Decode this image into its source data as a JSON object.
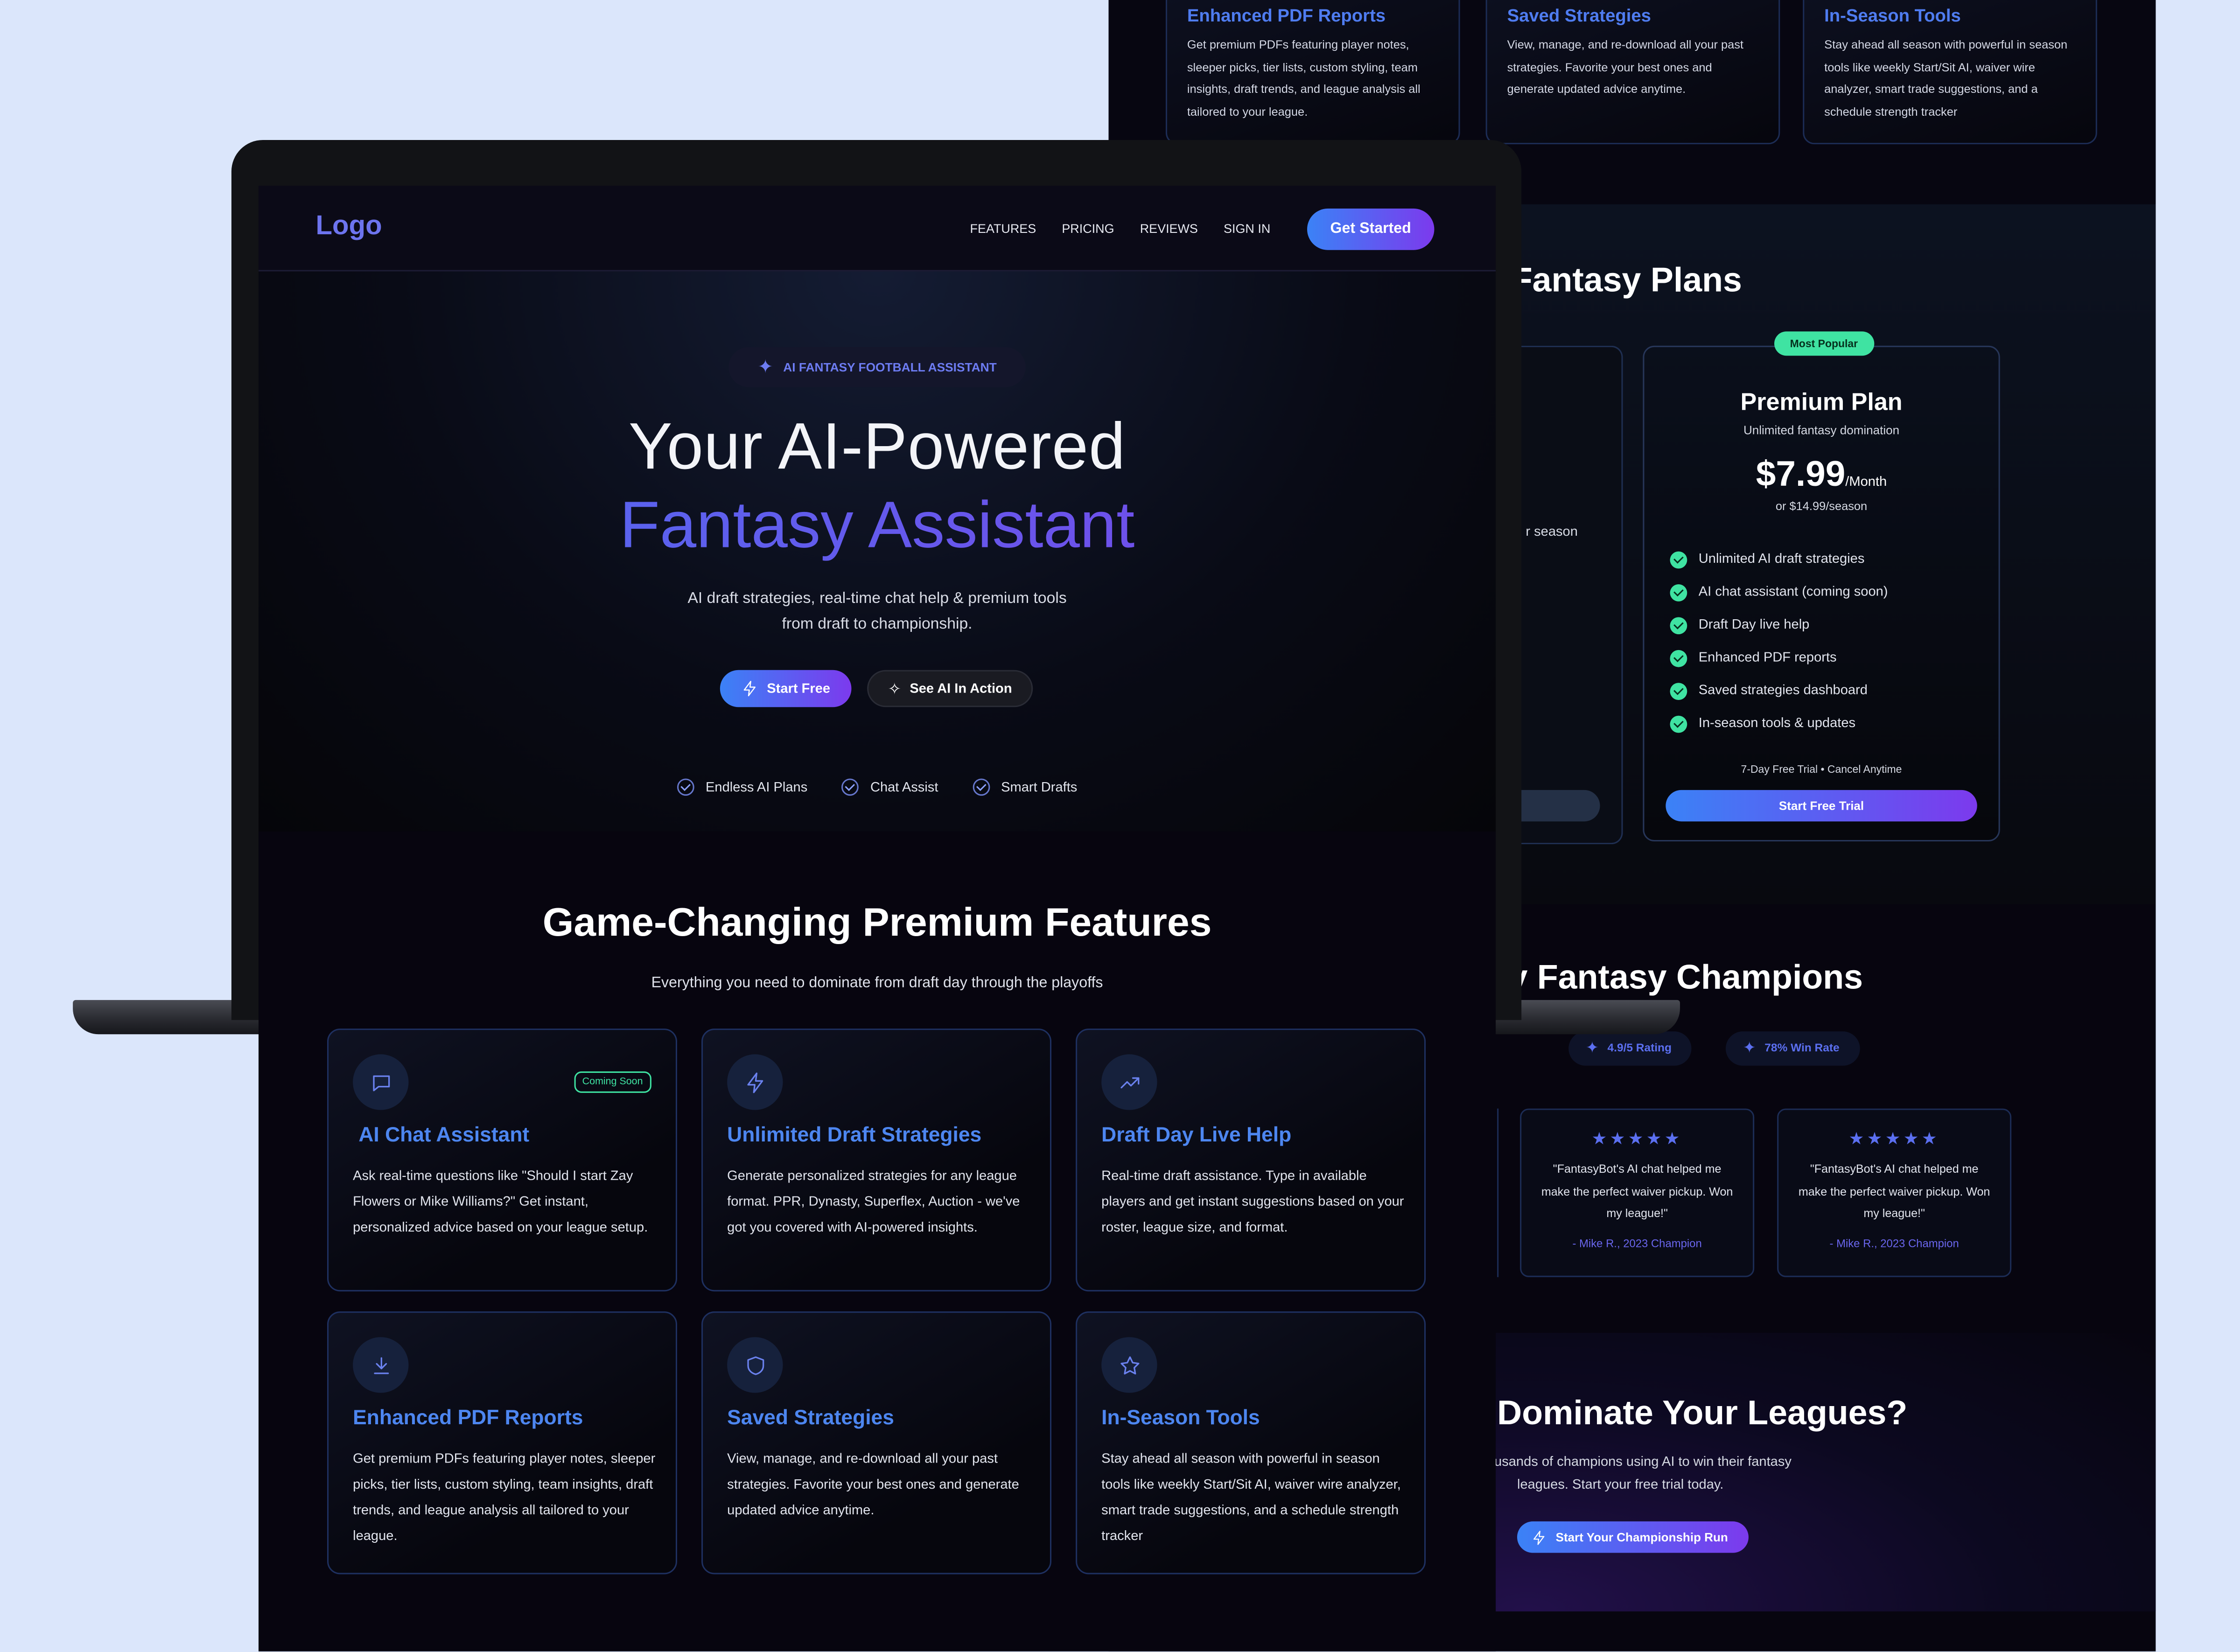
{
  "back_page": {
    "feature_cards": [
      {
        "title": "Enhanced PDF Reports",
        "body": "Get premium PDFs featuring player notes, sleeper picks, tier lists, custom styling, team insights, draft trends, and league analysis all tailored to your league."
      },
      {
        "title": "Saved Strategies",
        "body": "View, manage, and re-download all your past strategies. Favorite your best ones and generate updated advice anytime."
      },
      {
        "title": "In-Season Tools",
        "body": "Stay ahead all season with powerful in season tools like weekly Start/Sit AI, waiver wire analyzer, smart trade suggestions, and a schedule strength tracker"
      }
    ],
    "pricing": {
      "heading_visible": "Fantasy Plans",
      "left_card_fragment": "r season",
      "badge": "Most Popular",
      "plan_name": "Premium Plan",
      "plan_sub": "Unlimited fantasy domination",
      "price": "$7.99",
      "price_unit": "/Month",
      "alt_price": "or $14.99/season",
      "features": [
        "Unlimited AI draft strategies",
        "AI chat assistant (coming soon)",
        "Draft Day live help",
        "Enhanced PDF reports",
        "Saved strategies dashboard",
        "In-season tools & updates"
      ],
      "trial_note": "7-Day Free Trial • Cancel Anytime",
      "trial_button": "Start Free Trial"
    },
    "reviews": {
      "heading_visible": "y Fantasy Champions",
      "pills": [
        "4.9/5 Rating",
        "78% Win Rate"
      ],
      "stars": "★★★★★",
      "cards": [
        {
          "quote": "\"FantasyBot's AI chat helped me make the perfect waiver pickup. Won my league!\"",
          "author": "- Mike R., 2023 Champion"
        },
        {
          "quote": "\"FantasyBot's AI chat helped me make the perfect waiver pickup. Won my league!\"",
          "author": "- Mike R., 2023 Champion"
        }
      ]
    },
    "cta": {
      "heading_visible": "Dominate Your Leagues?",
      "sub_line1": "usands of champions using AI to win their fantasy",
      "sub_line2": "leagues. Start your free trial today.",
      "button": "Start Your Championship Run"
    }
  },
  "nav": {
    "logo": "Logo",
    "links": [
      "FEATURES",
      "PRICING",
      "REVIEWS",
      "SIGN IN"
    ],
    "cta": "Get Started"
  },
  "hero": {
    "badge": "AI FANTASY FOOTBALL ASSISTANT",
    "title_line1": "Your AI-Powered",
    "title_line2": "Fantasy Assistant",
    "sub_line1": "AI draft strategies, real-time chat help & premium tools",
    "sub_line2": "from draft to championship.",
    "primary_button": "Start Free",
    "secondary_button": "See AI In Action",
    "trust": [
      "Endless AI Plans",
      "Chat Assist",
      "Smart Drafts"
    ]
  },
  "features": {
    "title": "Game-Changing Premium Features",
    "subtitle": "Everything you need to dominate from draft day through the playoffs",
    "coming_soon": "Coming Soon",
    "cards": [
      {
        "icon": "chat-icon",
        "title": "AI Chat Assistant",
        "body": "Ask real-time questions like \"Should I start Zay Flowers or Mike Williams?\" Get instant, personalized advice based on your league setup."
      },
      {
        "icon": "lightning-icon",
        "title": "Unlimited Draft Strategies",
        "body": "Generate personalized strategies for any league format. PPR, Dynasty, Superflex, Auction - we've got you covered with AI-powered insights."
      },
      {
        "icon": "trend-up-icon",
        "title": "Draft Day Live Help",
        "body": "Real-time draft assistance. Type in available players and get instant suggestions based on your roster, league size, and format."
      },
      {
        "icon": "download-icon",
        "title": "Enhanced PDF Reports",
        "body": "Get premium PDFs featuring player notes, sleeper picks, tier lists, custom styling, team insights, draft trends, and league analysis all tailored to your league."
      },
      {
        "icon": "shield-icon",
        "title": "Saved Strategies",
        "body": "View, manage, and re-download all your past strategies. Favorite your best ones and generate updated advice anytime."
      },
      {
        "icon": "star-icon",
        "title": "In-Season Tools",
        "body": "Stay ahead all season with powerful in season tools like weekly Start/Sit AI, waiver wire analyzer, smart trade suggestions, and a schedule strength tracker"
      }
    ]
  }
}
